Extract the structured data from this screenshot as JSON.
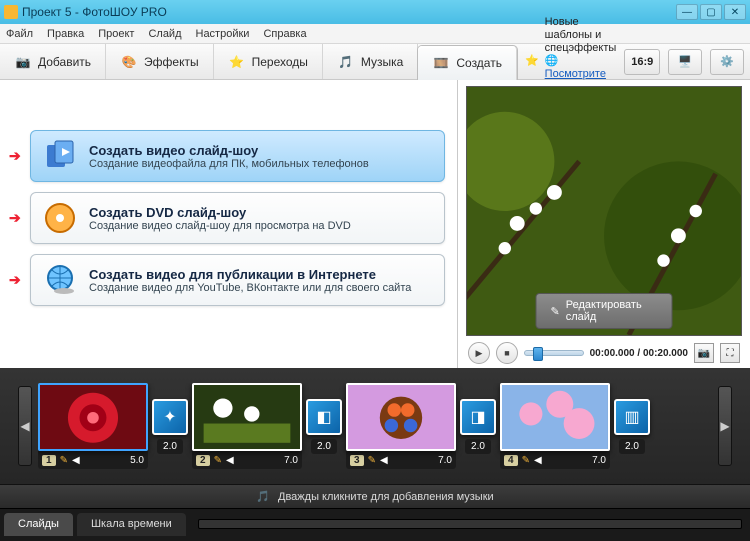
{
  "window": {
    "title": "Проект 5 - ФотоШОУ PRO"
  },
  "menu": [
    "Файл",
    "Правка",
    "Проект",
    "Слайд",
    "Настройки",
    "Справка"
  ],
  "tabs": {
    "add": "Добавить",
    "effects": "Эффекты",
    "transitions": "Переходы",
    "music": "Музыка",
    "create": "Создать"
  },
  "promo": {
    "line1": "Новые шаблоны и спецэффекты",
    "line2": "Посмотрите каталог на сайте..."
  },
  "aspect": "16:9",
  "options": [
    {
      "title": "Создать видео слайд-шоу",
      "desc": "Создание видеофайла для ПК, мобильных телефонов"
    },
    {
      "title": "Создать DVD слайд-шоу",
      "desc": "Создание видео слайд-шоу для просмотра на DVD"
    },
    {
      "title": "Создать видео для публикации в Интернете",
      "desc": "Создание видео для YouTube, ВКонтакте или для своего сайта"
    }
  ],
  "preview": {
    "edit": "Редактировать слайд",
    "time": "00:00.000 / 00:20.000"
  },
  "timeline": {
    "slides": [
      {
        "n": "1",
        "dur": "5.0"
      },
      {
        "n": "2",
        "dur": "7.0"
      },
      {
        "n": "3",
        "dur": "7.0"
      },
      {
        "n": "4",
        "dur": "7.0"
      }
    ],
    "transDur": "2.0",
    "music_hint": "Дважды кликните для добавления музыки"
  },
  "bottom_tabs": {
    "slides": "Слайды",
    "timeline": "Шкала времени"
  }
}
